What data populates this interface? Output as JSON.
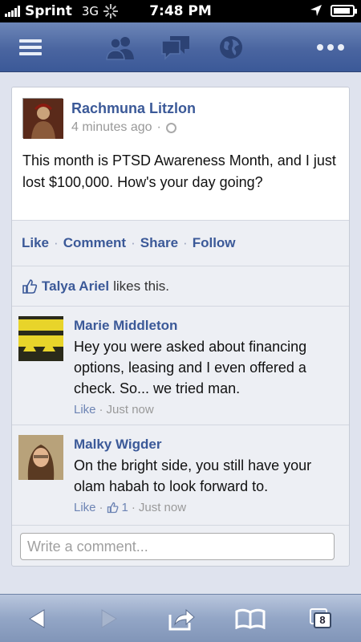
{
  "status_bar": {
    "carrier": "Sprint",
    "network": "3G",
    "time": "7:48 PM",
    "signal_bars": 5,
    "battery_level": 0.9,
    "icons": [
      "signal-icon",
      "activity-spinner-icon",
      "location-arrow-icon",
      "battery-icon"
    ]
  },
  "navbar": {
    "icons": [
      "menu-icon",
      "friend-requests-icon",
      "messages-icon",
      "notifications-globe-icon",
      "more-icon"
    ],
    "color": "#3b5998"
  },
  "post": {
    "author": "Rachmuna Litzlon",
    "timestamp": "4 minutes ago",
    "separator": "·",
    "privacy_icon": "globe-icon",
    "text": "This month is PTSD Awareness Month, and I just lost $100,000. How's your day going?",
    "actions": {
      "like": "Like",
      "comment": "Comment",
      "share": "Share",
      "follow": "Follow",
      "separator": "·"
    },
    "likes": {
      "name": "Talya Ariel",
      "suffix": "likes this."
    }
  },
  "comments": [
    {
      "author": "Marie Middleton",
      "text": "Hey you were asked about financing options, leasing and I even offered a check. So... we tried man.",
      "like_label": "Like",
      "separator": "·",
      "time": "Just now"
    },
    {
      "author": "Malky Wigder",
      "text": "On the bright side, you still have your olam habah to look forward to.",
      "like_label": "Like",
      "separator": "·",
      "like_count": "1",
      "separator2": "·",
      "time": "Just now"
    }
  ],
  "composer": {
    "placeholder": "Write a comment..."
  },
  "toolbar": {
    "tabs_count": "8",
    "icons": [
      "back-arrow-icon",
      "forward-arrow-icon",
      "share-icon",
      "bookmarks-icon",
      "tabs-icon"
    ]
  }
}
